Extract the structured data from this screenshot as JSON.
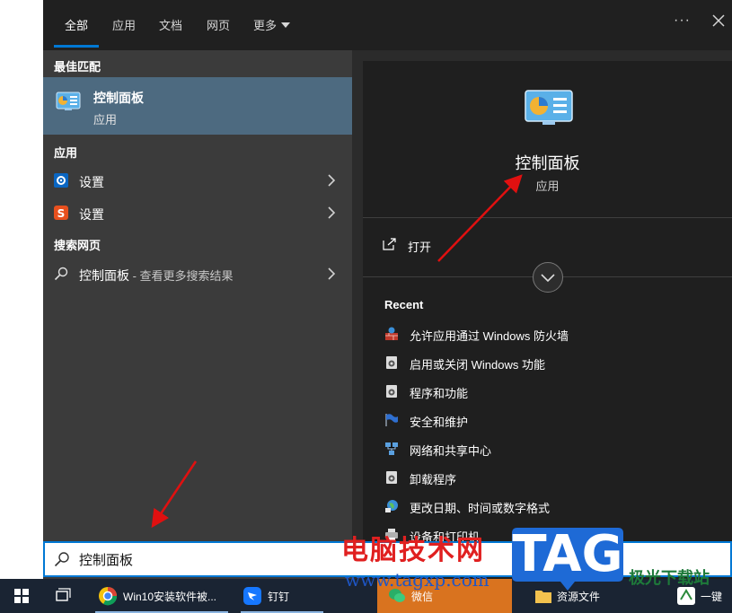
{
  "tabs": [
    {
      "label": "全部"
    },
    {
      "label": "应用"
    },
    {
      "label": "文档"
    },
    {
      "label": "网页"
    },
    {
      "label": "更多"
    }
  ],
  "topbar": {
    "more_dots": "···"
  },
  "left": {
    "best_match_title": "最佳匹配",
    "best_match": {
      "name": "控制面板",
      "type": "应用"
    },
    "apps_title": "应用",
    "apps": [
      {
        "label": "设置",
        "icon": "gear-icon"
      },
      {
        "label": "设置",
        "icon": "sogou-settings-icon"
      }
    ],
    "web_title": "搜索网页",
    "web_result": {
      "label": "控制面板",
      "sub": " - 查看更多搜索结果"
    }
  },
  "detail": {
    "name": "控制面板",
    "type": "应用",
    "open_label": "打开",
    "recent_title": "Recent",
    "recent": [
      {
        "label": "允许应用通过 Windows 防火墙",
        "icon": "firewall-icon"
      },
      {
        "label": "启用或关闭 Windows 功能",
        "icon": "windows-features-icon"
      },
      {
        "label": "程序和功能",
        "icon": "programs-icon"
      },
      {
        "label": "安全和维护",
        "icon": "security-flag-icon"
      },
      {
        "label": "网络和共享中心",
        "icon": "network-icon"
      },
      {
        "label": "卸载程序",
        "icon": "uninstall-icon"
      },
      {
        "label": "更改日期、时间或数字格式",
        "icon": "region-icon"
      },
      {
        "label": "设备和打印机",
        "icon": "devices-icon"
      }
    ]
  },
  "search": {
    "value": "控制面板"
  },
  "taskbar": {
    "items": [
      {
        "label": "Win10安装软件被..."
      },
      {
        "label": "钉钉"
      },
      {
        "label": "微信"
      },
      {
        "label": "资源文件"
      },
      {
        "label": "一键"
      }
    ]
  },
  "watermark": {
    "text": "电脑技术网",
    "url": "www.tagxp.com",
    "tag": "TAG",
    "site": "极光下载站"
  },
  "colors": {
    "accent": "#0078d4",
    "selected_bg": "#4d6a80",
    "panel_bg": "#2b2b2b",
    "arrow": "#e01010"
  }
}
